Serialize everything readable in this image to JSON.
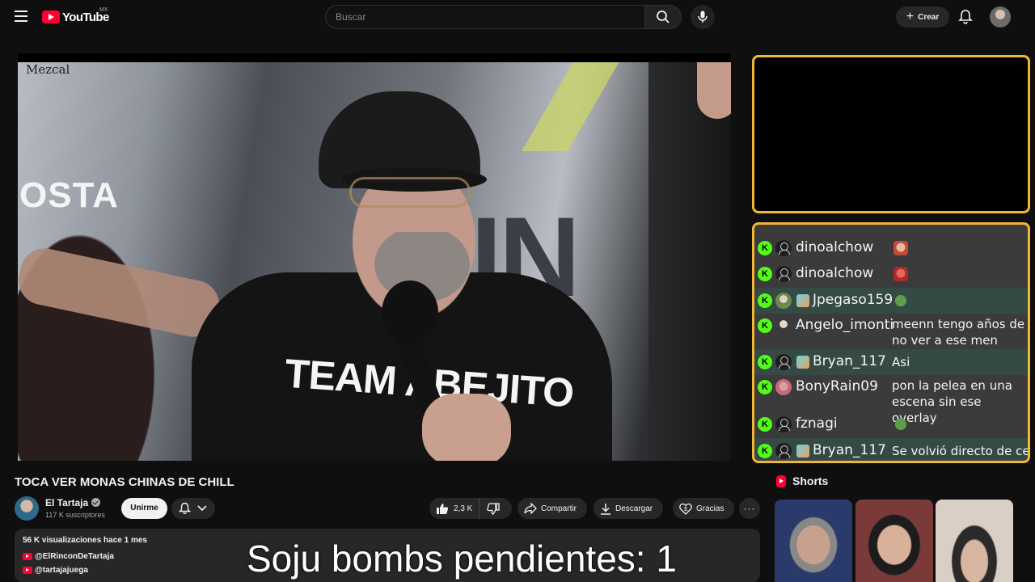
{
  "header": {
    "logo_text": "YouTube",
    "country_code": "MX",
    "search_placeholder": "Buscar",
    "create_label": "Crear"
  },
  "video": {
    "watermark": "Mezcal",
    "title": "TOCA VER MONAS CHINAS DE CHILL"
  },
  "channel": {
    "name": "El Tartaja",
    "subscribers": "117 K suscriptores",
    "join_label": "Unirme"
  },
  "actions": {
    "likes": "2,3 K",
    "share_label": "Compartir",
    "download_label": "Descargar",
    "thanks_label": "Gracias"
  },
  "description": {
    "meta": "56 K visualizaciones  hace 1 mes",
    "links": [
      "@ElRinconDeTartaja",
      "@tartajajuega"
    ]
  },
  "overlay": {
    "text": "Soju bombs pendientes: 1"
  },
  "chat": {
    "messages": [
      {
        "user": "dinoalchow",
        "text": "",
        "emote": "face"
      },
      {
        "user": "dinoalchow",
        "text": "",
        "emote": "face2"
      },
      {
        "user": "Jpegaso159",
        "text": "",
        "emote": "pepe"
      },
      {
        "user": "Angelo_imonti",
        "text": "meenn tengo años de no ver a ese men"
      },
      {
        "user": "Bryan_117",
        "text": "Asi"
      },
      {
        "user": "BonyRain09",
        "text": "pon la pelea en una escena sin ese overlay"
      },
      {
        "user": "fznagi",
        "text": "",
        "emote": "pepe"
      },
      {
        "user": "Bryan_117",
        "text": "Se volvió directo de cell"
      }
    ]
  },
  "shorts": {
    "header": "Shorts"
  },
  "colors": {
    "brand_red": "#ff0033",
    "overlay_border": "#f2b634",
    "kick_green": "#53fc18"
  }
}
